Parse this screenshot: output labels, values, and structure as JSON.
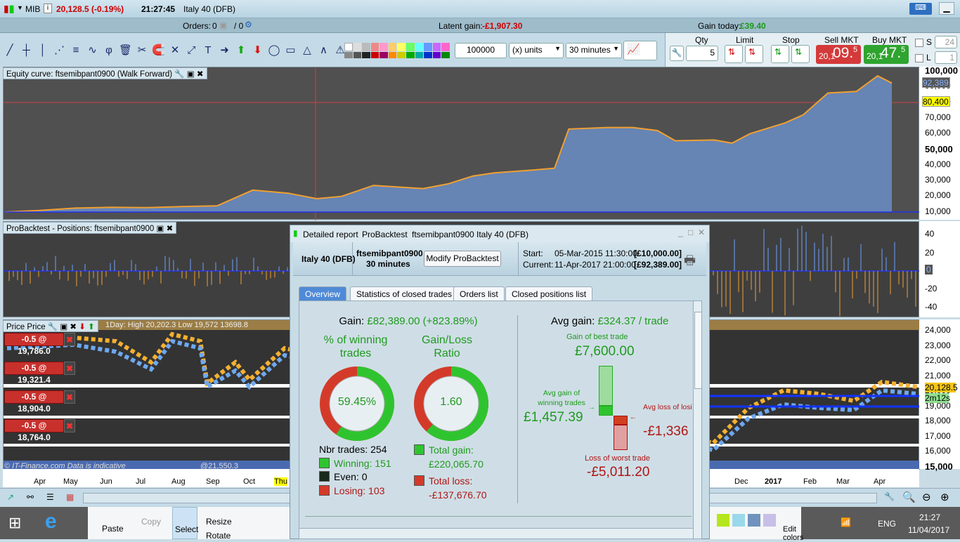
{
  "topbar": {
    "instrument": "MIB",
    "price": "20,128.5 (-0.19%)",
    "time": "21:27:45",
    "market": "Italy 40 (DFB)"
  },
  "orders": {
    "label": "Orders:",
    "count": "0",
    "separator": "/ 0",
    "latent_label": "Latent gain:",
    "latent_value": "-£1,907.30",
    "today_label": "Gain today:",
    "today_value": "£39.40"
  },
  "toolbar": {
    "drawing_tools": [
      "line-icon",
      "horizontal-line-icon",
      "vertical-line-icon",
      "fan-icon",
      "channel-icon",
      "trend-icon",
      "fibonacci-icon",
      "delete-icon",
      "tools-icon",
      "magnet-icon",
      "cross-icon",
      "measure-icon",
      "text-icon",
      "arrow-right-icon",
      "arrow-up-icon",
      "arrow-down-icon",
      "ellipse-icon",
      "rectangle-icon",
      "triangle-icon",
      "zigzag-icon",
      "pattern-icon"
    ],
    "amount": "100000",
    "units": "(x) units",
    "timeframe": "30 minutes",
    "qty_label": "Qty",
    "qty": "5",
    "limit_label": "Limit",
    "stop_label": "Stop",
    "sell_label": "Sell MKT",
    "sell_small": "20,1",
    "sell_big": "09.",
    "sell_sup": "5",
    "buy_label": "Buy MKT",
    "buy_small": "20,1",
    "buy_big": "47.",
    "buy_sup": "5",
    "s_label": "S",
    "s_value": "24",
    "l_label": "L",
    "l_value": "1"
  },
  "equity": {
    "title": "Equity curve: ftsemibpant0900 (Walk Forward)",
    "current": "92,389",
    "marker": "80,400",
    "axis": [
      "100,000",
      "90,000",
      "80,000",
      "70,000",
      "60,000",
      "50,000",
      "40,000",
      "30,000",
      "20,000",
      "10,000"
    ],
    "series": [
      [
        0,
        10000
      ],
      [
        1,
        11000
      ],
      [
        2,
        12500
      ],
      [
        3,
        13000
      ],
      [
        4,
        12800
      ],
      [
        5,
        13500
      ],
      [
        6,
        14000
      ],
      [
        7,
        24000
      ],
      [
        8,
        22000
      ],
      [
        8.8,
        18500
      ],
      [
        9.5,
        20000
      ],
      [
        10.4,
        27000
      ],
      [
        11.8,
        25000
      ],
      [
        12.5,
        28000
      ],
      [
        13.2,
        33000
      ],
      [
        13.8,
        35000
      ],
      [
        15,
        37000
      ],
      [
        15.5,
        38000
      ],
      [
        15.9,
        63000
      ],
      [
        17,
        64000
      ],
      [
        17.7,
        64000
      ],
      [
        18.4,
        62000
      ],
      [
        18.9,
        55500
      ],
      [
        20,
        56000
      ],
      [
        20.5,
        54000
      ],
      [
        21,
        60000
      ],
      [
        22,
        67000
      ],
      [
        22.5,
        72000
      ],
      [
        23.2,
        86000
      ],
      [
        24,
        87000
      ],
      [
        24.6,
        97000
      ],
      [
        25,
        92389
      ]
    ]
  },
  "positions": {
    "title": "ProBacktest - Positions: ftsemibpant0900",
    "axis": [
      "40",
      "20",
      "0",
      "-20",
      "-40"
    ]
  },
  "price": {
    "title": "Price Price",
    "info": "1Day: High 20,202.3 Low 19,572 13698.8",
    "orders": [
      "-0.5 @ 19,786.0",
      "-0.5 @ 19,321.4",
      "-0.5 @ 18,904.0",
      "-0.5 @ 18,764.0"
    ],
    "axis": [
      "24,000",
      "23,000",
      "22,000",
      "21,000",
      "20,000",
      "19,000",
      "18,000",
      "17,000",
      "16,000",
      "15,000"
    ],
    "last": "20,128.5",
    "countdown": "2m12s",
    "watermark": "© IT-Finance.com  Data is indicative",
    "volume_label": "@21,550.3",
    "months": [
      "Apr",
      "May",
      "Jun",
      "Jul",
      "Aug",
      "Sep",
      "Oct",
      "Thu",
      "Dec",
      "2017",
      "Feb",
      "Mar",
      "Apr"
    ]
  },
  "dialog": {
    "title_parts": [
      "Detailed report",
      "ProBacktest",
      "ftsemibpant0900",
      "Italy 40 (DFB)"
    ],
    "market": "Italy 40 (DFB)",
    "system": "ftsemibpant0900",
    "timeframe": "30 minutes",
    "modify": "Modify ProBacktest",
    "start_label": "Start:",
    "start_date": "05-Mar-2015 11:30:00",
    "start_value": "[£10,000.00]",
    "current_label": "Current:",
    "current_date": "11-Apr-2017 21:00:00",
    "current_value": "[£92,389.00]",
    "tabs": [
      "Overview",
      "Statistics of closed trades",
      "Orders list",
      "Closed positions list"
    ],
    "gain_label": "Gain:",
    "gain_value": "£82,389.00 (+823.89%)",
    "win_title": "% of winning trades",
    "win_pct": "59.45%",
    "win_fraction": 0.5945,
    "ratio_title": "Gain/Loss Ratio",
    "ratio": "1.60",
    "ratio_fraction": 0.615,
    "nbr": "Nbr trades: 254",
    "winning": "Winning: 151",
    "even": "Even: 0",
    "losing": "Losing: 103",
    "total_gain_label": "Total gain:",
    "total_gain": "£220,065.70",
    "total_loss_label": "Total loss:",
    "total_loss": "-£137,676.70",
    "avg_label": "Avg gain:",
    "avg_value": "£324.37 / trade",
    "best_label": "Gain of best trade",
    "best": "£7,600.00",
    "avg_win_label": "Avg gain of winning trades",
    "avg_win": "£1,457.39",
    "avg_loss_label": "Avg loss of losing trades",
    "avg_loss": "-£1,336",
    "worst_label": "Loss of worst trade",
    "worst": "-£5,011.20"
  },
  "taskbar": {
    "paste": "Paste",
    "copy": "Copy",
    "select": "Select",
    "resize": "Resize",
    "rotate": "Rotate",
    "edit_colors": "Edit colors",
    "lang": "ENG",
    "time": "21:27",
    "date": "11/04/2017"
  }
}
